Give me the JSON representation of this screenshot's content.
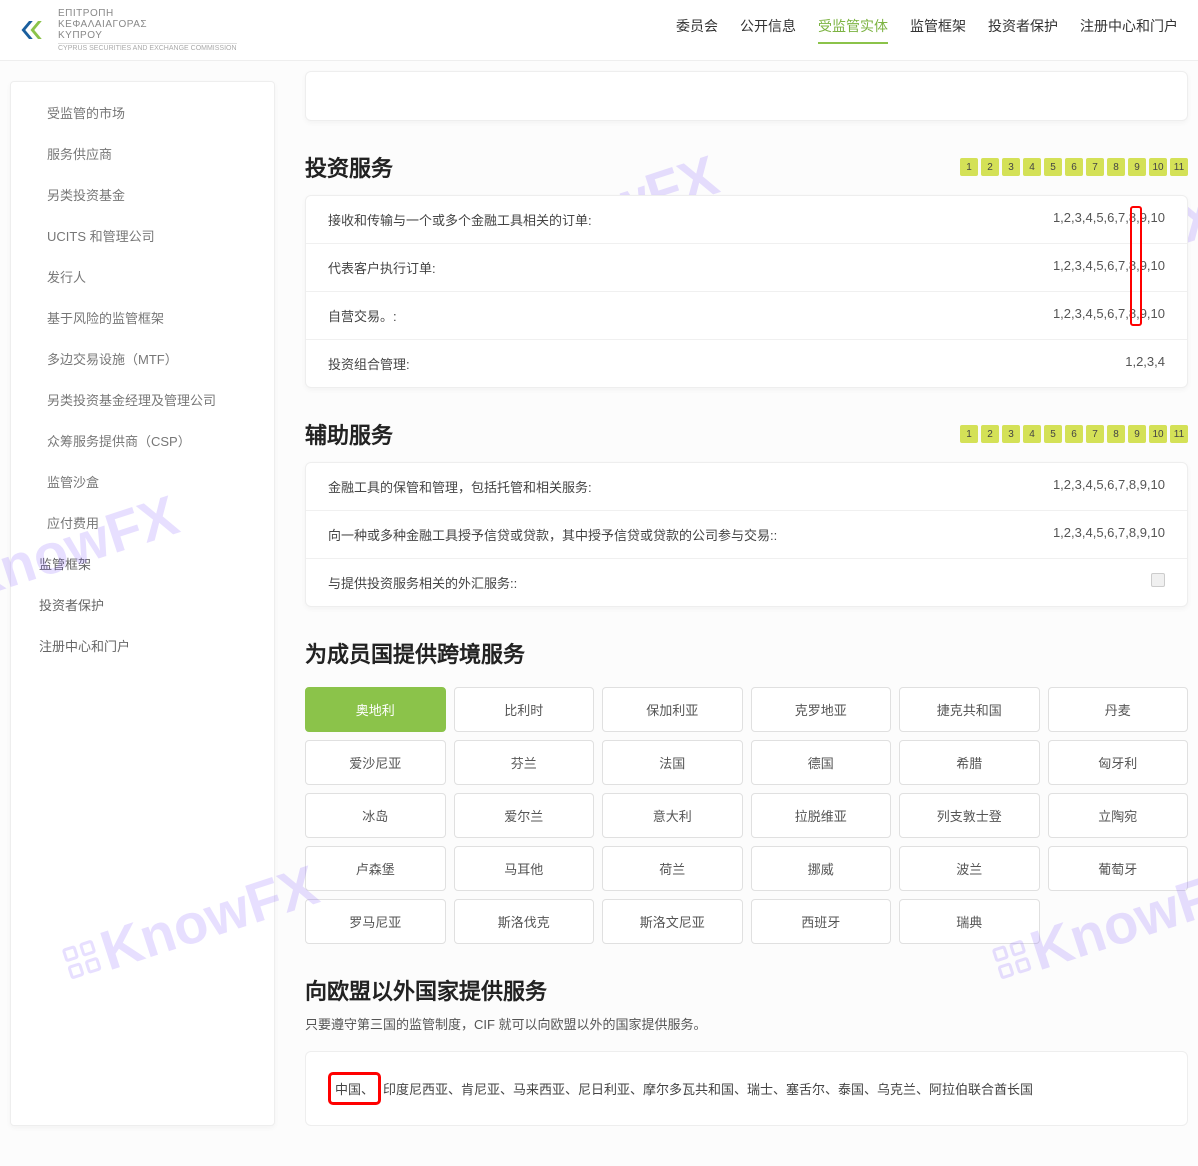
{
  "header": {
    "logo_lines": [
      "ΕΠΙΤΡΟΠΗ",
      "ΚΕΦΑΛΑΙΑΓΟΡΑΣ",
      "ΚΥΠΡΟΥ"
    ],
    "logo_sub": "CYPRUS SECURITIES AND EXCHANGE COMMISSION",
    "nav": [
      "委员会",
      "公开信息",
      "受监管实体",
      "监管框架",
      "投资者保护",
      "注册中心和门户"
    ],
    "active": 2
  },
  "sidebar": {
    "items": [
      {
        "label": "受监管的市场",
        "lvl": 2
      },
      {
        "label": "服务供应商",
        "lvl": 2
      },
      {
        "label": "另类投资基金",
        "lvl": 2
      },
      {
        "label": "UCITS 和管理公司",
        "lvl": 2
      },
      {
        "label": "发行人",
        "lvl": 2
      },
      {
        "label": "基于风险的监管框架",
        "lvl": 2
      },
      {
        "label": "多边交易设施（MTF）",
        "lvl": 2
      },
      {
        "label": "另类投资基金经理及管理公司",
        "lvl": 2
      },
      {
        "label": "众筹服务提供商（CSP）",
        "lvl": 2
      },
      {
        "label": "监管沙盒",
        "lvl": 2
      },
      {
        "label": "应付费用",
        "lvl": 2
      },
      {
        "label": "监管框架",
        "lvl": 1
      },
      {
        "label": "投资者保护",
        "lvl": 1
      },
      {
        "label": "注册中心和门户",
        "lvl": 1
      }
    ]
  },
  "invest": {
    "title": "投资服务",
    "nums": [
      "1",
      "2",
      "3",
      "4",
      "5",
      "6",
      "7",
      "8",
      "9",
      "10",
      "11"
    ],
    "rows": [
      {
        "label": "接收和传输与一个或多个金融工具相关的订单:",
        "val": "1,2,3,4,5,6,7,8,9,10"
      },
      {
        "label": "代表客户执行订单:",
        "val": "1,2,3,4,5,6,7,8,9,10"
      },
      {
        "label": "自营交易。:",
        "val": "1,2,3,4,5,6,7,8,9,10"
      },
      {
        "label": "投资组合管理:",
        "val": "1,2,3,4"
      }
    ]
  },
  "aux": {
    "title": "辅助服务",
    "nums": [
      "1",
      "2",
      "3",
      "4",
      "5",
      "6",
      "7",
      "8",
      "9",
      "10",
      "11"
    ],
    "rows": [
      {
        "label": "金融工具的保管和管理，包括托管和相关服务:",
        "val": "1,2,3,4,5,6,7,8,9,10"
      },
      {
        "label": "向一种或多种金融工具授予信贷或贷款，其中授予信贷或贷款的公司参与交易::",
        "val": "1,2,3,4,5,6,7,8,9,10"
      },
      {
        "label": "与提供投资服务相关的外汇服务::",
        "val": "",
        "check": true
      }
    ]
  },
  "cross": {
    "title": "为成员国提供跨境服务",
    "countries": [
      "奥地利",
      "比利时",
      "保加利亚",
      "克罗地亚",
      "捷克共和国",
      "丹麦",
      "爱沙尼亚",
      "芬兰",
      "法国",
      "德国",
      "希腊",
      "匈牙利",
      "冰岛",
      "爱尔兰",
      "意大利",
      "拉脱维亚",
      "列支敦士登",
      "立陶宛",
      "卢森堡",
      "马耳他",
      "荷兰",
      "挪威",
      "波兰",
      "葡萄牙",
      "罗马尼亚",
      "斯洛伐克",
      "斯洛文尼亚",
      "西班牙",
      "瑞典"
    ],
    "active": 0
  },
  "outside": {
    "title": "向欧盟以外国家提供服务",
    "note": "只要遵守第三国的监管制度，CIF 就可以向欧盟以外的国家提供服务。",
    "highlighted": "中国、",
    "rest": "印度尼西亚、肯尼亚、马来西亚、尼日利亚、摩尔多瓦共和国、瑞士、塞舌尔、泰国、乌克兰、阿拉伯联合酋长国"
  },
  "watermark": "KnowFX"
}
